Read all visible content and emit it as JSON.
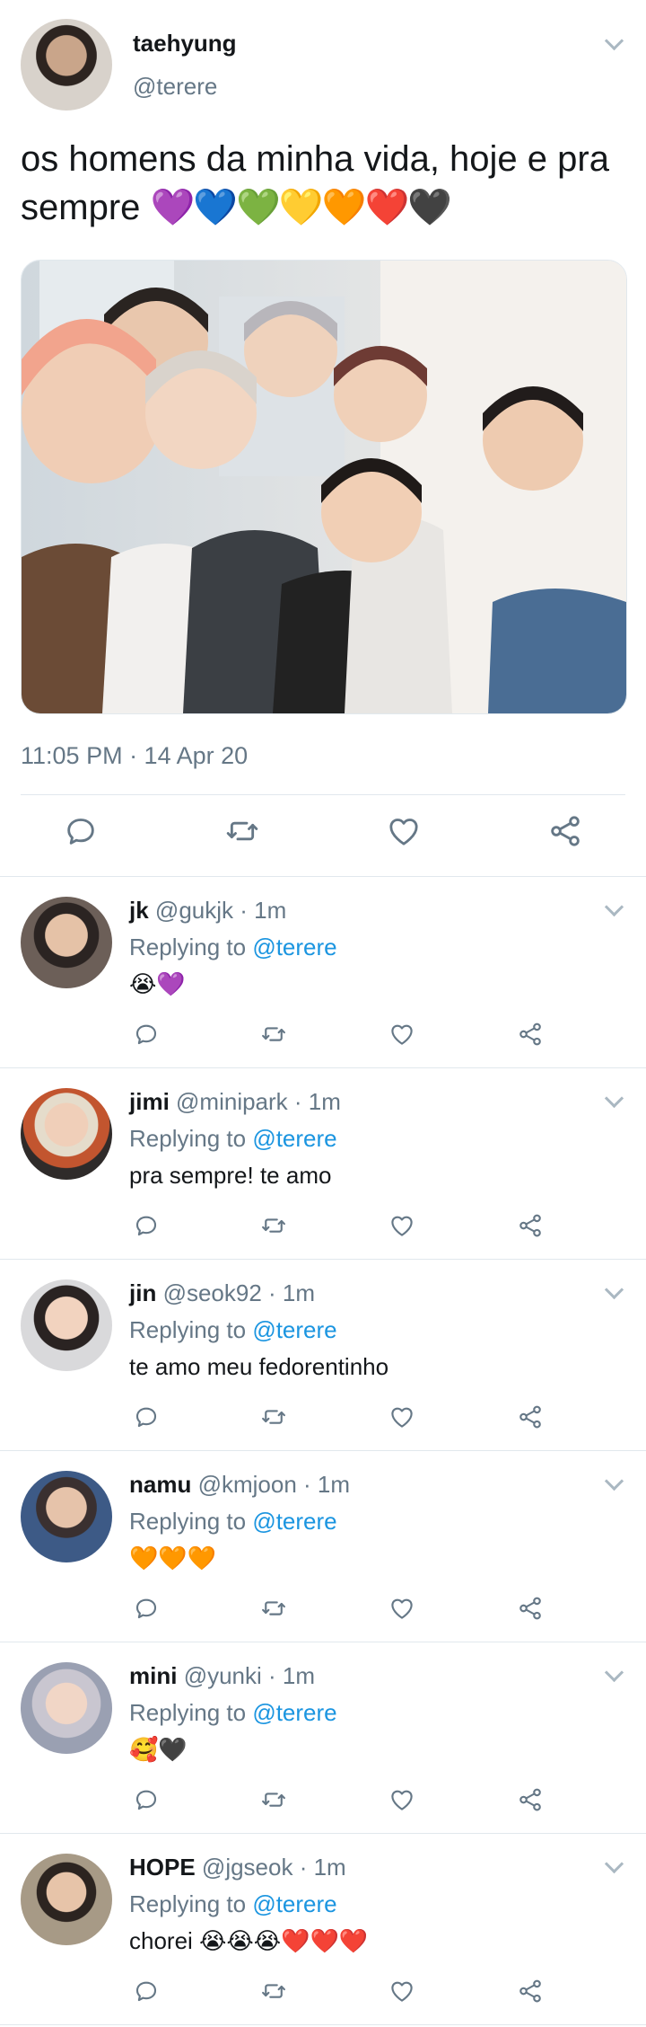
{
  "tweet": {
    "name": "taehyung",
    "handle": "@terere",
    "text": "os homens da minha vida, hoje e pra sempre",
    "hearts": "💜💙💚💛🧡❤️🖤",
    "timestamp": "11:05 PM · 14 Apr 20",
    "photo_icon": "group-photo"
  },
  "replies": [
    {
      "name": "jk",
      "meta": "@gukjk · 1m",
      "replying": "Replying to",
      "mention": "@terere",
      "text": "😭💜"
    },
    {
      "name": "jimi",
      "meta": "@minipark · 1m",
      "replying": "Replying to",
      "mention": "@terere",
      "text": "pra sempre! te amo"
    },
    {
      "name": "jin",
      "meta": "@seok92 · 1m",
      "replying": "Replying to",
      "mention": "@terere",
      "text": "te amo meu fedorentinho"
    },
    {
      "name": "namu",
      "meta": "@kmjoon · 1m",
      "replying": "Replying to",
      "mention": "@terere",
      "text": "🧡🧡🧡"
    },
    {
      "name": "mini",
      "meta": "@yunki · 1m",
      "replying": "Replying to",
      "mention": "@terere",
      "text": "🥰🖤"
    },
    {
      "name": "HOPE",
      "meta": "@jgseok · 1m",
      "replying": "Replying to",
      "mention": "@terere",
      "text": "chorei 😭😭😭❤️❤️❤️"
    }
  ],
  "icons": {
    "reply": "reply-icon",
    "retweet": "retweet-icon",
    "like": "like-icon",
    "share": "share-icon",
    "menu": "chevron-down-icon"
  },
  "colors": {
    "text": "#14171a",
    "secondary": "#657786",
    "link": "#1b95e0",
    "border": "#e1e8ed",
    "icon": "#657786"
  }
}
